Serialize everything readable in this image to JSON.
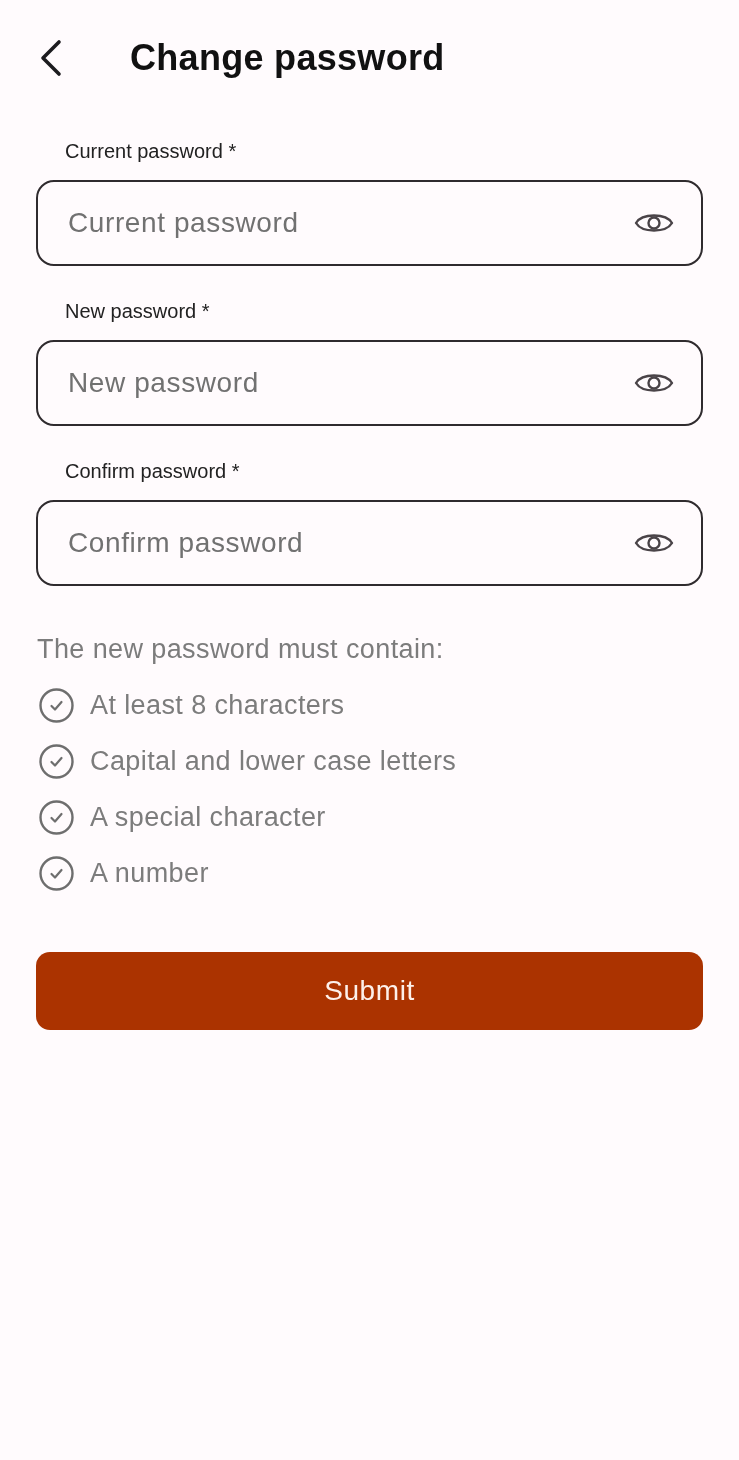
{
  "header": {
    "title": "Change password"
  },
  "fields": [
    {
      "label": "Current password *",
      "placeholder": "Current password"
    },
    {
      "label": "New password *",
      "placeholder": "New password"
    },
    {
      "label": "Confirm password *",
      "placeholder": "Confirm password"
    }
  ],
  "requirements": {
    "heading": "The new password must contain:",
    "items": [
      {
        "text": "At least 8 characters",
        "met": false
      },
      {
        "text": "Capital and lower case letters",
        "met": false
      },
      {
        "text": "A special character",
        "met": false
      },
      {
        "text": "A number",
        "met": false
      }
    ]
  },
  "submit": {
    "label": "Submit"
  }
}
